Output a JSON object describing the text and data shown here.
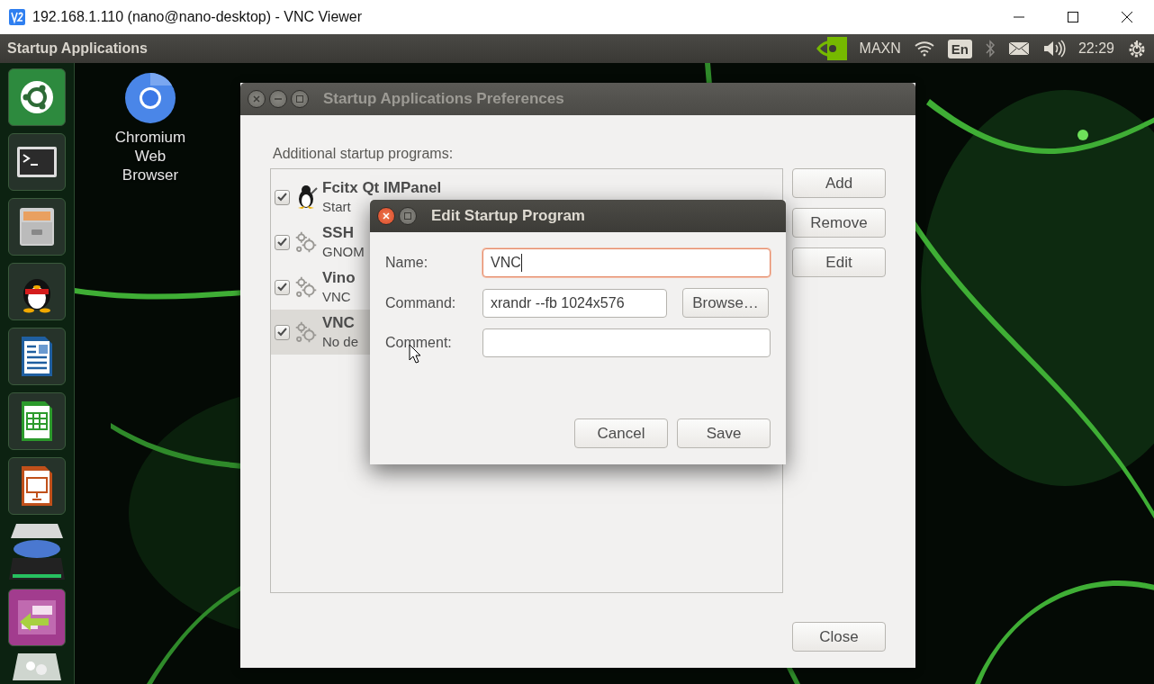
{
  "vnc_window": {
    "title": "192.168.1.110 (nano@nano-desktop) - VNC Viewer"
  },
  "top_panel": {
    "app_title": "Startup Applications",
    "power_mode": "MAXN",
    "keyboard_layout": "En",
    "clock": "22:29"
  },
  "desktop_icons": [
    {
      "label": "Chromium Web Browser"
    }
  ],
  "preferences_window": {
    "title": "Startup Applications Preferences",
    "list_label": "Additional startup programs:",
    "programs": [
      {
        "name": "Fcitx Qt IMPanel",
        "description": "Start",
        "checked": true,
        "selected": false,
        "kind": "penguin"
      },
      {
        "name": "SSH",
        "description": "GNOM",
        "checked": true,
        "selected": false,
        "kind": "gears"
      },
      {
        "name": "Vino",
        "description": "VNC",
        "checked": true,
        "selected": false,
        "kind": "gears"
      },
      {
        "name": "VNC",
        "description": "No de",
        "checked": true,
        "selected": true,
        "kind": "gears"
      }
    ],
    "buttons": [
      "Add",
      "Remove",
      "Edit"
    ],
    "close_button": "Close"
  },
  "edit_dialog": {
    "title": "Edit Startup Program",
    "fields": [
      {
        "label": "Name:",
        "value": "VNC",
        "focused": true
      },
      {
        "label": "Command:",
        "value": "xrandr --fb 1024x576",
        "focused": false,
        "browse_button": "Browse…"
      },
      {
        "label": "Comment:",
        "focused": false
      }
    ],
    "buttons": [
      "Cancel",
      "Save"
    ]
  }
}
